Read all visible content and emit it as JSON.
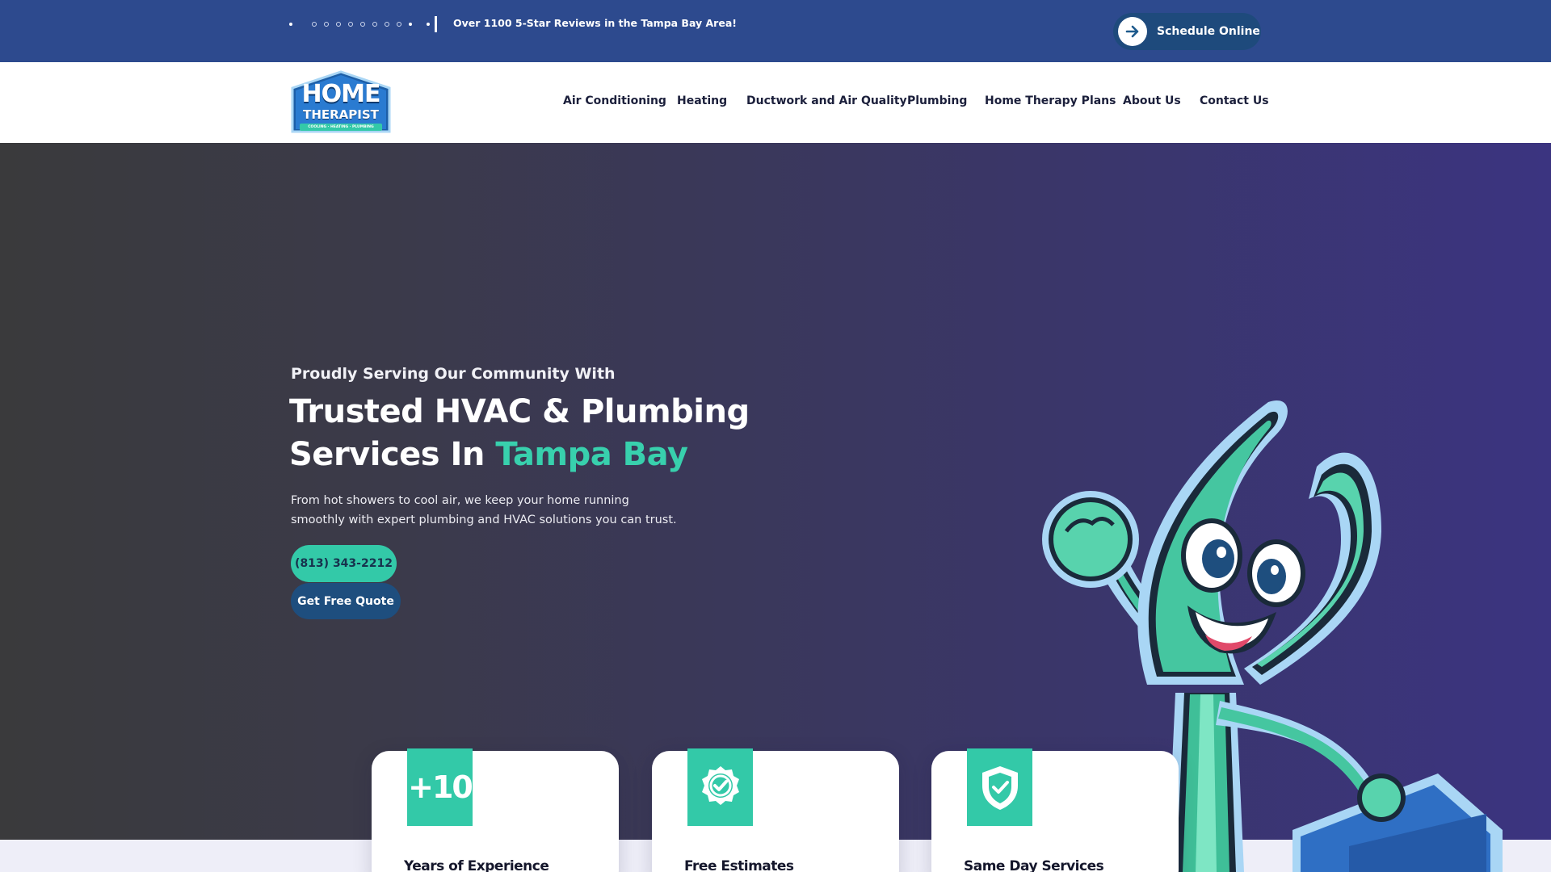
{
  "topbar": {
    "reviews_text": "Over 1100 5-Star Reviews in the Tampa Bay Area!",
    "schedule_label": "Schedule Online",
    "schedule_icon": "arrow-right-icon"
  },
  "logo": {
    "line1": "HOME",
    "line2": "THERAPIST",
    "tagline": "COOLING · HEATING · PLUMBING"
  },
  "nav": {
    "items": [
      {
        "label": "Air Conditioning"
      },
      {
        "label": "Heating"
      },
      {
        "label": "Ductwork and Air Quality"
      },
      {
        "label": "Plumbing"
      },
      {
        "label": "Home Therapy Plans"
      },
      {
        "label": "About Us"
      },
      {
        "label": "Contact Us"
      }
    ]
  },
  "hero": {
    "subtitle": "Proudly Serving Our Community With",
    "headline_line1": "Trusted HVAC & Plumbing",
    "headline_line2_prefix": "Services In ",
    "headline_accent": "Tampa Bay",
    "description": "From hot showers to cool air, we keep your home running smoothly with expert plumbing and HVAC solutions you can trust.",
    "phone_label": "(813) 343-2212",
    "quote_label": "Get Free Quote"
  },
  "features": [
    {
      "badge": "+10",
      "icon": "years-badge",
      "title": "Years of Experience"
    },
    {
      "badge": "",
      "icon": "check-seal-icon",
      "title": "Free Estimates"
    },
    {
      "badge": "",
      "icon": "shield-check-icon",
      "title": "Same Day Services"
    }
  ],
  "colors": {
    "topbar": "#2d4a8e",
    "accent": "#33c9a8",
    "dark_button": "#1e4e7e",
    "nav_text": "#1b1f3b"
  }
}
